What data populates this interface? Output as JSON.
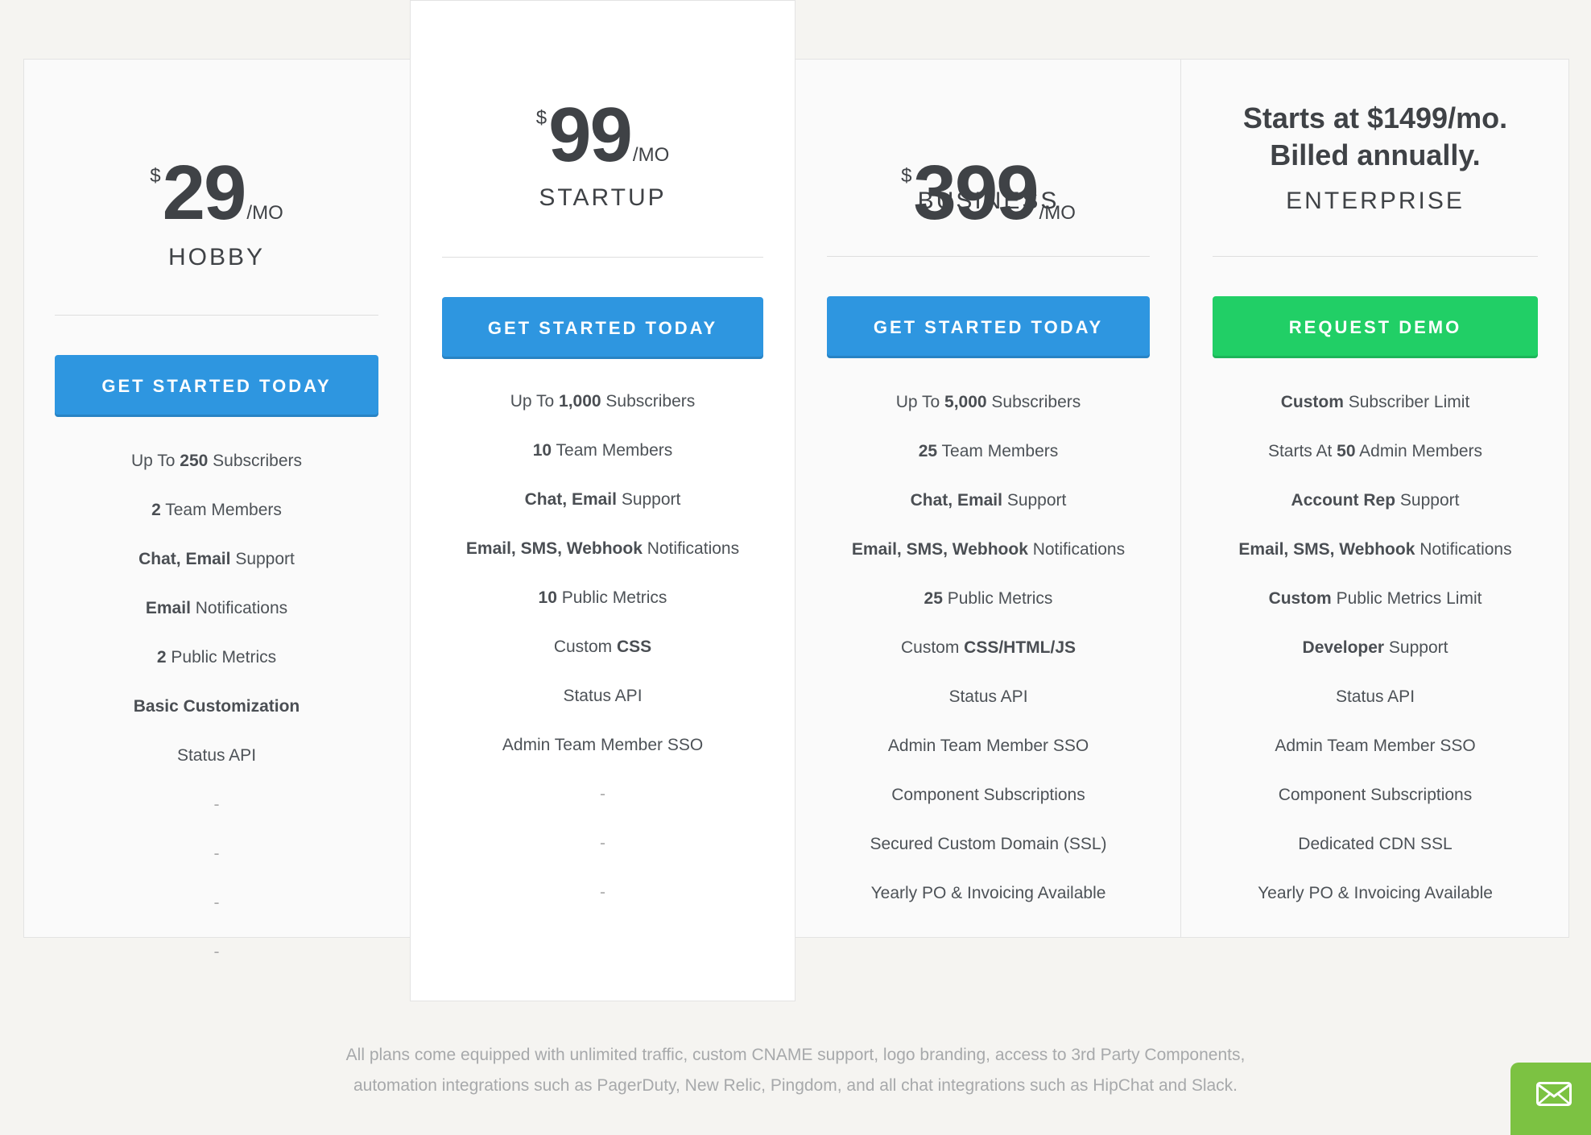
{
  "plans": [
    {
      "currency": "$",
      "amount": "29",
      "per": "/MO",
      "name": "HOBBY",
      "cta": "GET STARTED TODAY",
      "features": [
        [
          {
            "t": "Up To "
          },
          {
            "t": "250",
            "b": true
          },
          {
            "t": " Subscribers"
          }
        ],
        [
          {
            "t": "2",
            "b": true
          },
          {
            "t": " Team Members"
          }
        ],
        [
          {
            "t": "Chat, Email",
            "b": true
          },
          {
            "t": " Support"
          }
        ],
        [
          {
            "t": "Email",
            "b": true
          },
          {
            "t": " Notifications"
          }
        ],
        [
          {
            "t": "2",
            "b": true
          },
          {
            "t": " Public Metrics"
          }
        ],
        [
          {
            "t": "Basic Customization",
            "b": true
          }
        ],
        [
          {
            "t": "Status API"
          }
        ],
        [
          {
            "t": "-",
            "d": true
          }
        ],
        [
          {
            "t": "-",
            "d": true
          }
        ],
        [
          {
            "t": "-",
            "d": true
          }
        ],
        [
          {
            "t": "-",
            "d": true
          }
        ]
      ]
    },
    {
      "currency": "$",
      "amount": "99",
      "per": "/MO",
      "name": "STARTUP",
      "cta": "GET STARTED TODAY",
      "features": [
        [
          {
            "t": "Up To "
          },
          {
            "t": "1,000",
            "b": true
          },
          {
            "t": " Subscribers"
          }
        ],
        [
          {
            "t": "10",
            "b": true
          },
          {
            "t": " Team Members"
          }
        ],
        [
          {
            "t": "Chat, Email",
            "b": true
          },
          {
            "t": " Support"
          }
        ],
        [
          {
            "t": "Email, SMS, Webhook",
            "b": true
          },
          {
            "t": " Notifications"
          }
        ],
        [
          {
            "t": "10",
            "b": true
          },
          {
            "t": " Public Metrics"
          }
        ],
        [
          {
            "t": "Custom "
          },
          {
            "t": "CSS",
            "b": true
          }
        ],
        [
          {
            "t": "Status API"
          }
        ],
        [
          {
            "t": "Admin Team Member SSO"
          }
        ],
        [
          {
            "t": "-",
            "d": true
          }
        ],
        [
          {
            "t": "-",
            "d": true
          }
        ],
        [
          {
            "t": "-",
            "d": true
          }
        ]
      ]
    },
    {
      "currency": "$",
      "amount": "399",
      "per": "/MO",
      "name": "BUSINESS",
      "cta": "GET STARTED TODAY",
      "features": [
        [
          {
            "t": "Up To "
          },
          {
            "t": "5,000",
            "b": true
          },
          {
            "t": " Subscribers"
          }
        ],
        [
          {
            "t": "25",
            "b": true
          },
          {
            "t": " Team Members"
          }
        ],
        [
          {
            "t": "Chat, Email",
            "b": true
          },
          {
            "t": " Support"
          }
        ],
        [
          {
            "t": "Email, SMS, Webhook",
            "b": true
          },
          {
            "t": " Notifications"
          }
        ],
        [
          {
            "t": "25",
            "b": true
          },
          {
            "t": " Public Metrics"
          }
        ],
        [
          {
            "t": "Custom "
          },
          {
            "t": "CSS/HTML/JS",
            "b": true
          }
        ],
        [
          {
            "t": "Status API"
          }
        ],
        [
          {
            "t": "Admin Team Member SSO"
          }
        ],
        [
          {
            "t": "Component Subscriptions"
          }
        ],
        [
          {
            "t": "Secured Custom Domain (SSL)"
          }
        ],
        [
          {
            "t": "Yearly PO & Invoicing Available"
          }
        ]
      ]
    },
    {
      "price_line1": "Starts at $1499/mo.",
      "price_line2": "Billed annually.",
      "name": "ENTERPRISE",
      "cta": "REQUEST DEMO",
      "features": [
        [
          {
            "t": "Custom",
            "b": true
          },
          {
            "t": " Subscriber Limit"
          }
        ],
        [
          {
            "t": "Starts At "
          },
          {
            "t": "50",
            "b": true
          },
          {
            "t": " Admin Members"
          }
        ],
        [
          {
            "t": "Account Rep",
            "b": true
          },
          {
            "t": " Support"
          }
        ],
        [
          {
            "t": "Email, SMS, Webhook",
            "b": true
          },
          {
            "t": " Notifications"
          }
        ],
        [
          {
            "t": "Custom",
            "b": true
          },
          {
            "t": " Public Metrics Limit"
          }
        ],
        [
          {
            "t": "Developer",
            "b": true
          },
          {
            "t": " Support"
          }
        ],
        [
          {
            "t": "Status API"
          }
        ],
        [
          {
            "t": "Admin Team Member SSO"
          }
        ],
        [
          {
            "t": "Component Subscriptions"
          }
        ],
        [
          {
            "t": "Dedicated CDN SSL"
          }
        ],
        [
          {
            "t": "Yearly PO & Invoicing Available"
          }
        ]
      ]
    }
  ],
  "footer": {
    "line1": "All plans come equipped with unlimited traffic, custom CNAME support, logo branding, access to 3rd Party Components,",
    "line2": "automation integrations such as PagerDuty, New Relic, Pingdom, and all chat integrations such as HipChat and Slack."
  },
  "colors": {
    "primary_button": "#2e96e0",
    "demo_button": "#21cf66",
    "chat_widget": "#7cc242"
  },
  "icons": {
    "chat_widget": "envelope-icon"
  }
}
